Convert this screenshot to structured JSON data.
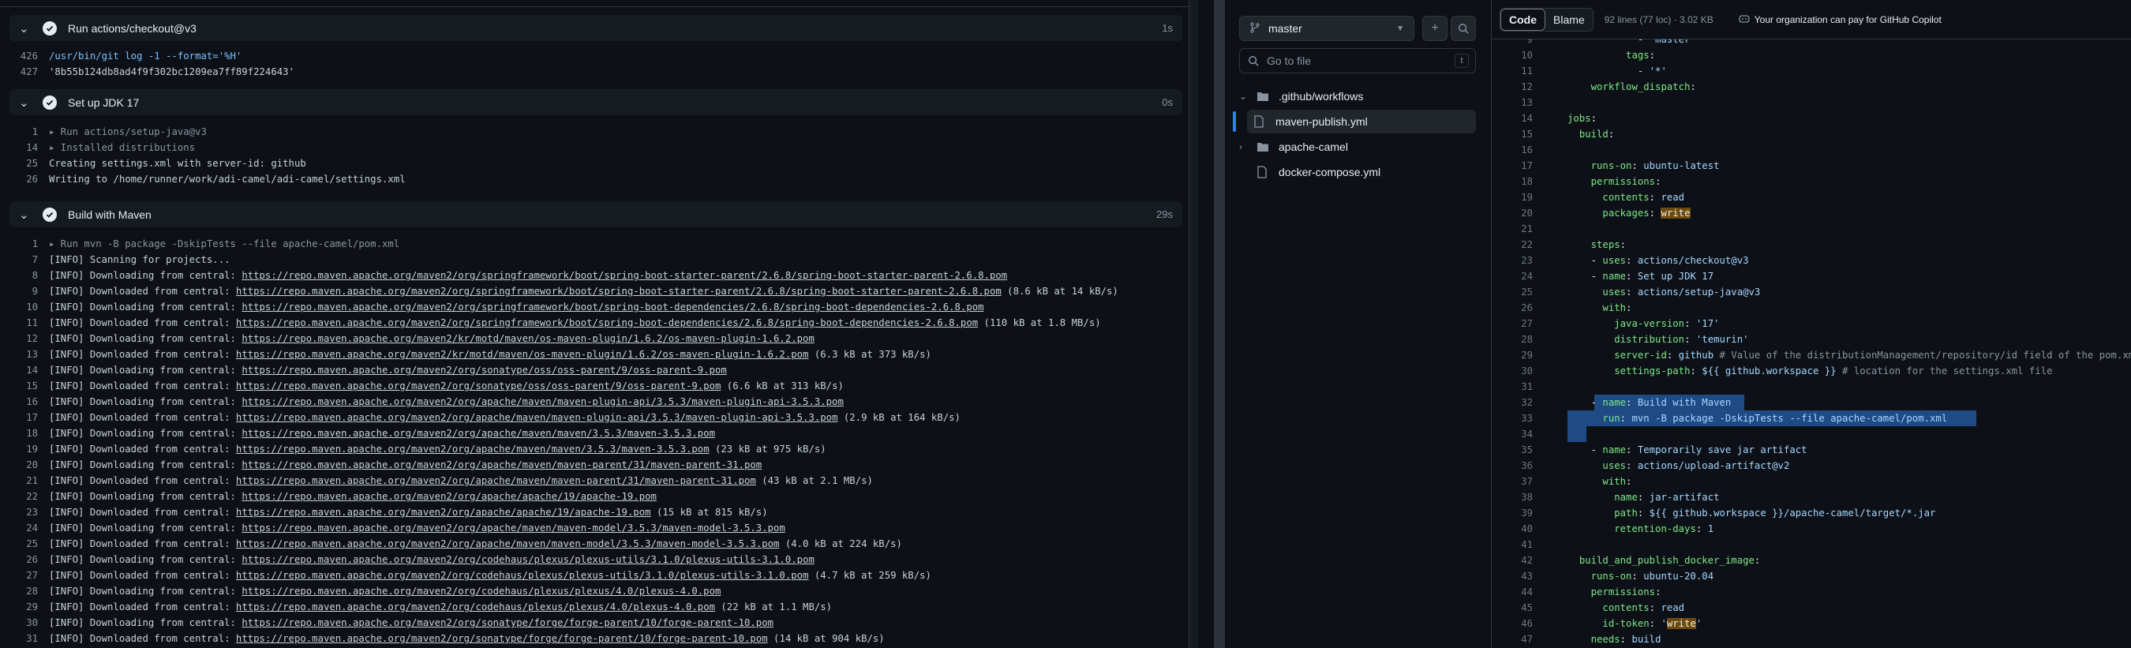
{
  "log": {
    "steps": [
      {
        "title": "Run actions/checkout@v3",
        "duration": "1s",
        "lines": [
          {
            "no": "426",
            "text": "/usr/bin/git log -1 --format='%H'",
            "style": "blue"
          },
          {
            "no": "427",
            "text": "'8b55b124db8ad4f9f302bc1209ea7ff89f224643'",
            "style": "plain"
          }
        ]
      },
      {
        "title": "Set up JDK 17",
        "duration": "0s",
        "lines": [
          {
            "no": "1",
            "text": "▸ Run actions/setup-java@v3",
            "style": "grey"
          },
          {
            "no": "14",
            "text": "▸ Installed distributions",
            "style": "grey"
          },
          {
            "no": "25",
            "text": "Creating settings.xml with server-id: github",
            "style": "plain"
          },
          {
            "no": "26",
            "text": "Writing to /home/runner/work/adi-camel/adi-camel/settings.xml",
            "style": "plain"
          }
        ]
      },
      {
        "title": "Build with Maven",
        "duration": "29s",
        "lines": [
          {
            "no": "1",
            "text": "▸ Run mvn -B package -DskipTests --file apache-camel/pom.xml",
            "style": "grey"
          },
          {
            "no": "7",
            "text": "[INFO] Scanning for projects...",
            "style": "plain"
          },
          {
            "no": "8",
            "prefix": "[INFO] Downloading from central: ",
            "url": "https://repo.maven.apache.org/maven2/org/springframework/boot/spring-boot-starter-parent/2.6.8/spring-boot-starter-parent-2.6.8.pom",
            "suffix": ""
          },
          {
            "no": "9",
            "prefix": "[INFO] Downloaded from central: ",
            "url": "https://repo.maven.apache.org/maven2/org/springframework/boot/spring-boot-starter-parent/2.6.8/spring-boot-starter-parent-2.6.8.pom",
            "suffix": " (8.6 kB at 14 kB/s)"
          },
          {
            "no": "10",
            "prefix": "[INFO] Downloading from central: ",
            "url": "https://repo.maven.apache.org/maven2/org/springframework/boot/spring-boot-dependencies/2.6.8/spring-boot-dependencies-2.6.8.pom",
            "suffix": ""
          },
          {
            "no": "11",
            "prefix": "[INFO] Downloaded from central: ",
            "url": "https://repo.maven.apache.org/maven2/org/springframework/boot/spring-boot-dependencies/2.6.8/spring-boot-dependencies-2.6.8.pom",
            "suffix": " (110 kB at 1.8 MB/s)"
          },
          {
            "no": "12",
            "prefix": "[INFO] Downloading from central: ",
            "url": "https://repo.maven.apache.org/maven2/kr/motd/maven/os-maven-plugin/1.6.2/os-maven-plugin-1.6.2.pom",
            "suffix": ""
          },
          {
            "no": "13",
            "prefix": "[INFO] Downloaded from central: ",
            "url": "https://repo.maven.apache.org/maven2/kr/motd/maven/os-maven-plugin/1.6.2/os-maven-plugin-1.6.2.pom",
            "suffix": " (6.3 kB at 373 kB/s)"
          },
          {
            "no": "14",
            "prefix": "[INFO] Downloading from central: ",
            "url": "https://repo.maven.apache.org/maven2/org/sonatype/oss/oss-parent/9/oss-parent-9.pom",
            "suffix": ""
          },
          {
            "no": "15",
            "prefix": "[INFO] Downloaded from central: ",
            "url": "https://repo.maven.apache.org/maven2/org/sonatype/oss/oss-parent/9/oss-parent-9.pom",
            "suffix": " (6.6 kB at 313 kB/s)"
          },
          {
            "no": "16",
            "prefix": "[INFO] Downloading from central: ",
            "url": "https://repo.maven.apache.org/maven2/org/apache/maven/maven-plugin-api/3.5.3/maven-plugin-api-3.5.3.pom",
            "suffix": ""
          },
          {
            "no": "17",
            "prefix": "[INFO] Downloaded from central: ",
            "url": "https://repo.maven.apache.org/maven2/org/apache/maven/maven-plugin-api/3.5.3/maven-plugin-api-3.5.3.pom",
            "suffix": " (2.9 kB at 164 kB/s)"
          },
          {
            "no": "18",
            "prefix": "[INFO] Downloading from central: ",
            "url": "https://repo.maven.apache.org/maven2/org/apache/maven/maven/3.5.3/maven-3.5.3.pom",
            "suffix": ""
          },
          {
            "no": "19",
            "prefix": "[INFO] Downloaded from central: ",
            "url": "https://repo.maven.apache.org/maven2/org/apache/maven/maven/3.5.3/maven-3.5.3.pom",
            "suffix": " (23 kB at 975 kB/s)"
          },
          {
            "no": "20",
            "prefix": "[INFO] Downloading from central: ",
            "url": "https://repo.maven.apache.org/maven2/org/apache/maven/maven-parent/31/maven-parent-31.pom",
            "suffix": ""
          },
          {
            "no": "21",
            "prefix": "[INFO] Downloaded from central: ",
            "url": "https://repo.maven.apache.org/maven2/org/apache/maven/maven-parent/31/maven-parent-31.pom",
            "suffix": " (43 kB at 2.1 MB/s)"
          },
          {
            "no": "22",
            "prefix": "[INFO] Downloading from central: ",
            "url": "https://repo.maven.apache.org/maven2/org/apache/apache/19/apache-19.pom",
            "suffix": ""
          },
          {
            "no": "23",
            "prefix": "[INFO] Downloaded from central: ",
            "url": "https://repo.maven.apache.org/maven2/org/apache/apache/19/apache-19.pom",
            "suffix": " (15 kB at 815 kB/s)"
          },
          {
            "no": "24",
            "prefix": "[INFO] Downloading from central: ",
            "url": "https://repo.maven.apache.org/maven2/org/apache/maven/maven-model/3.5.3/maven-model-3.5.3.pom",
            "suffix": ""
          },
          {
            "no": "25",
            "prefix": "[INFO] Downloaded from central: ",
            "url": "https://repo.maven.apache.org/maven2/org/apache/maven/maven-model/3.5.3/maven-model-3.5.3.pom",
            "suffix": " (4.0 kB at 224 kB/s)"
          },
          {
            "no": "26",
            "prefix": "[INFO] Downloading from central: ",
            "url": "https://repo.maven.apache.org/maven2/org/codehaus/plexus/plexus-utils/3.1.0/plexus-utils-3.1.0.pom",
            "suffix": ""
          },
          {
            "no": "27",
            "prefix": "[INFO] Downloaded from central: ",
            "url": "https://repo.maven.apache.org/maven2/org/codehaus/plexus/plexus-utils/3.1.0/plexus-utils-3.1.0.pom",
            "suffix": " (4.7 kB at 259 kB/s)"
          },
          {
            "no": "28",
            "prefix": "[INFO] Downloading from central: ",
            "url": "https://repo.maven.apache.org/maven2/org/codehaus/plexus/plexus/4.0/plexus-4.0.pom",
            "suffix": ""
          },
          {
            "no": "29",
            "prefix": "[INFO] Downloaded from central: ",
            "url": "https://repo.maven.apache.org/maven2/org/codehaus/plexus/plexus/4.0/plexus-4.0.pom",
            "suffix": " (22 kB at 1.1 MB/s)"
          },
          {
            "no": "30",
            "prefix": "[INFO] Downloading from central: ",
            "url": "https://repo.maven.apache.org/maven2/org/sonatype/forge/forge-parent/10/forge-parent-10.pom",
            "suffix": ""
          },
          {
            "no": "31",
            "prefix": "[INFO] Downloaded from central: ",
            "url": "https://repo.maven.apache.org/maven2/org/sonatype/forge/forge-parent/10/forge-parent-10.pom",
            "suffix": " (14 kB at 904 kB/s)"
          }
        ]
      }
    ]
  },
  "tree": {
    "branch": "master",
    "search_placeholder": "Go to file",
    "search_shortcut": "t",
    "items": [
      {
        "label": ".github/workflows",
        "type": "folder",
        "expanded": true
      },
      {
        "label": "maven-publish.yml",
        "type": "file",
        "selected": true
      },
      {
        "label": "apache-camel",
        "type": "folder",
        "expanded": false
      },
      {
        "label": "docker-compose.yml",
        "type": "file"
      }
    ]
  },
  "code": {
    "tab_code": "Code",
    "tab_blame": "Blame",
    "file_info": "92 lines (77 loc) · 3.02 KB",
    "copilot_text": "Your organization can pay for GitHub Copilot",
    "lines": [
      {
        "no": "9",
        "text": "            - \"master\""
      },
      {
        "no": "10",
        "text": "          tags:"
      },
      {
        "no": "11",
        "text": "            - '*'"
      },
      {
        "no": "12",
        "text": "    workflow_dispatch:"
      },
      {
        "no": "13",
        "text": ""
      },
      {
        "no": "14",
        "text": "jobs:"
      },
      {
        "no": "15",
        "text": "  build:"
      },
      {
        "no": "16",
        "text": ""
      },
      {
        "no": "17",
        "text": "    runs-on: ubuntu-latest"
      },
      {
        "no": "18",
        "text": "    permissions:"
      },
      {
        "no": "19",
        "text": "      contents: read"
      },
      {
        "no": "20",
        "text": "      packages: write"
      },
      {
        "no": "21",
        "text": ""
      },
      {
        "no": "22",
        "text": "    steps:"
      },
      {
        "no": "23",
        "text": "    - uses: actions/checkout@v3"
      },
      {
        "no": "24",
        "text": "    - name: Set up JDK 17"
      },
      {
        "no": "25",
        "text": "      uses: actions/setup-java@v3"
      },
      {
        "no": "26",
        "text": "      with:"
      },
      {
        "no": "27",
        "text": "        java-version: '17'"
      },
      {
        "no": "28",
        "text": "        distribution: 'temurin'"
      },
      {
        "no": "29",
        "text": "        server-id: github # Value of the distributionManagement/repository/id field of the pom.xml"
      },
      {
        "no": "30",
        "text": "        settings-path: ${{ github.workspace }} # location for the settings.xml file"
      },
      {
        "no": "31",
        "text": ""
      },
      {
        "no": "32",
        "text": "    - name: Build with Maven"
      },
      {
        "no": "33",
        "text": "      run: mvn -B package -DskipTests --file apache-camel/pom.xml"
      },
      {
        "no": "34",
        "text": ""
      },
      {
        "no": "35",
        "text": "    - name: Temporarily save jar artifact"
      },
      {
        "no": "36",
        "text": "      uses: actions/upload-artifact@v2"
      },
      {
        "no": "37",
        "text": "      with:"
      },
      {
        "no": "38",
        "text": "        name: jar-artifact"
      },
      {
        "no": "39",
        "text": "        path: ${{ github.workspace }}/apache-camel/target/*.jar"
      },
      {
        "no": "40",
        "text": "        retention-days: 1"
      },
      {
        "no": "41",
        "text": ""
      },
      {
        "no": "42",
        "text": "  build_and_publish_docker_image:"
      },
      {
        "no": "43",
        "text": "    runs-on: ubuntu-20.04"
      },
      {
        "no": "44",
        "text": "    permissions:"
      },
      {
        "no": "45",
        "text": "      contents: read"
      },
      {
        "no": "46",
        "text": "      id-token: 'write'"
      },
      {
        "no": "47",
        "text": "    needs: build"
      }
    ]
  }
}
